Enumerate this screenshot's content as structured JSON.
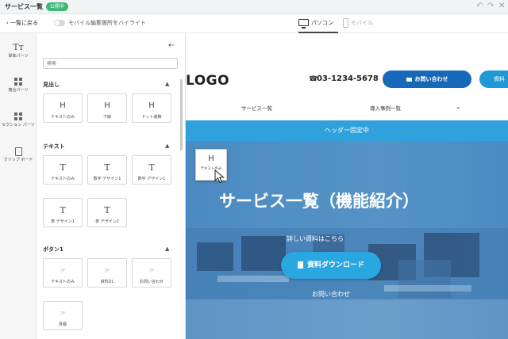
{
  "app": {
    "title": "サービス一覧",
    "status": "公開中"
  },
  "toolbar": {
    "back": "一覧に戻る",
    "highlight_toggle": "モバイル編集箇所をハイライト",
    "view_pc": "パソコン",
    "view_mobile": "モバイル"
  },
  "rail": [
    {
      "label": "単体パーツ",
      "icon": "text-parts-icon"
    },
    {
      "label": "複合パーツ",
      "icon": "grid-icon"
    },
    {
      "label": "セクション パーツ",
      "icon": "grid-icon"
    },
    {
      "label": "クリップ ボード",
      "icon": "clipboard-icon"
    }
  ],
  "panel": {
    "search_placeholder": "検索",
    "sections": [
      {
        "title": "見出し",
        "items": [
          {
            "glyph": "H",
            "label": "テキストのみ"
          },
          {
            "glyph": "H",
            "label": "下線"
          },
          {
            "glyph": "H",
            "label": "ドット装飾"
          }
        ]
      },
      {
        "title": "テキスト",
        "items": [
          {
            "glyph": "T",
            "label": "テキストのみ"
          },
          {
            "glyph": "T",
            "label": "数字 デザイン1"
          },
          {
            "glyph": "T",
            "label": "数字 デザイン1"
          },
          {
            "glyph": "T",
            "label": "表 デザイン1"
          },
          {
            "glyph": "T",
            "label": "表 デザイン2"
          }
        ]
      },
      {
        "title": "ボタン1",
        "items": [
          {
            "glyph": "☞",
            "label": "テキストのみ"
          },
          {
            "glyph": "☞",
            "label": "資料DL"
          },
          {
            "glyph": "☞",
            "label": "お問い合わせ"
          },
          {
            "glyph": "☞",
            "label": "見積"
          }
        ]
      }
    ]
  },
  "canvas": {
    "logo": "LOGO",
    "phone": "03-1234-5678",
    "contact_button": "お問い合わせ",
    "doc_button": "資料",
    "nav": [
      "サービス一覧",
      "導入事例一覧"
    ],
    "fixed_header": "ヘッダー固定中",
    "hero_title": "サービス一覧（機能紹介）",
    "hero_sub": "詳しい資料はこちら",
    "hero_cta": "資料ダウンロード",
    "hero_link": "お問い合わせ"
  },
  "drag_preview": {
    "glyph": "H",
    "label": "テキストのみ"
  }
}
